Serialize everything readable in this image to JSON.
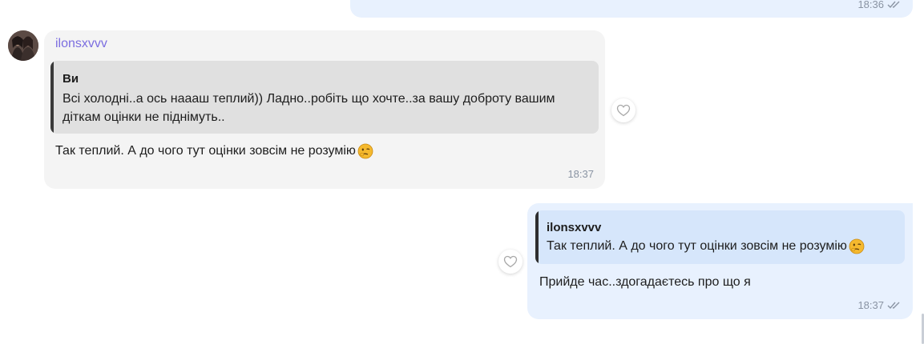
{
  "previous_message": {
    "time": "18:36",
    "status_icon": "double-check-icon"
  },
  "incoming_message": {
    "sender": "ilonsxvvv",
    "avatar_icon": "user-avatar",
    "reply": {
      "author": "Ви",
      "text": "Всі холодні..а ось наааш теплий)) Ладно..робіть що хочте..за вашу доброту вашим діткам оцінки не піднімуть.."
    },
    "text": "Так теплий. А до чого тут оцінки зовсім не розумію",
    "emoji_icon": "face-emoji",
    "time": "18:37"
  },
  "outgoing_message": {
    "reply": {
      "author": "ilonsxvvv",
      "text": "Так теплий. А до чого тут оцінки зовсім не розумію",
      "emoji_icon": "face-emoji"
    },
    "text": "Прийде час..здогадаєтесь про що я",
    "time": "18:37",
    "status_icon": "double-check-icon"
  },
  "react_icon": "heart-icon",
  "colors": {
    "incoming_bg": "#f4f4f4",
    "outgoing_bg": "#e8f1fe",
    "sender_name": "#7c6ee0",
    "meta_text": "#8a94a3"
  }
}
